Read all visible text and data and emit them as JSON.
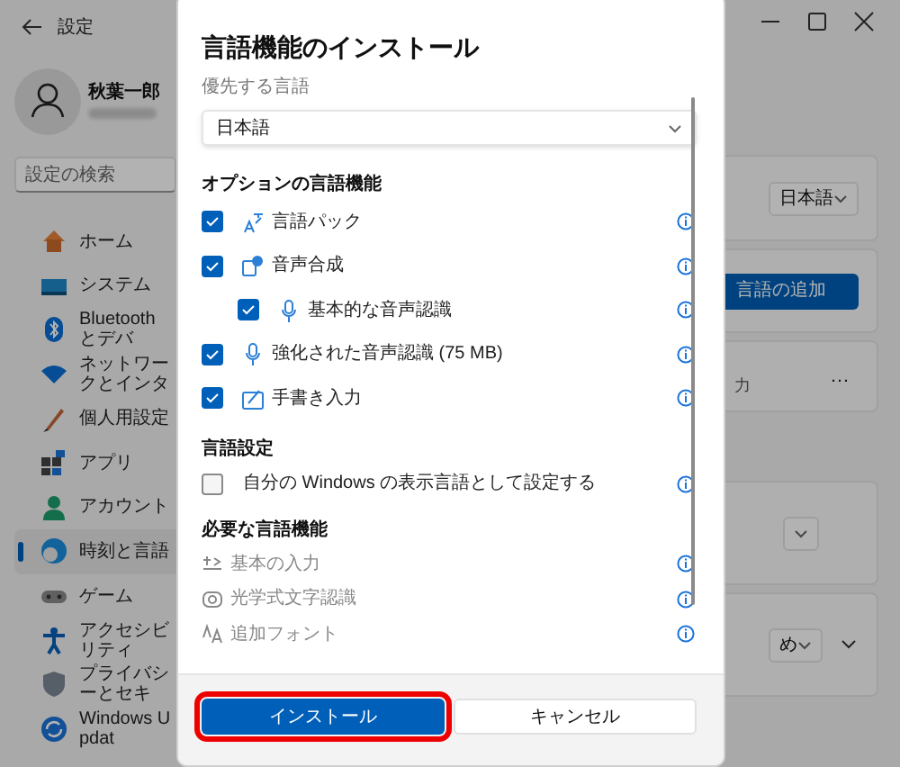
{
  "settings_window": {
    "title": "設定",
    "user": {
      "name": "秋葉一郎"
    },
    "search": {
      "placeholder": "設定の検索"
    },
    "sidebar": {
      "items": [
        {
          "label": "ホーム",
          "selected": false
        },
        {
          "label": "システム",
          "selected": false
        },
        {
          "label": "Bluetooth とデバ",
          "selected": false
        },
        {
          "label": "ネットワークとインタ",
          "selected": false
        },
        {
          "label": "個人用設定",
          "selected": false
        },
        {
          "label": "アプリ",
          "selected": false
        },
        {
          "label": "アカウント",
          "selected": false
        },
        {
          "label": "時刻と言語",
          "selected": true
        },
        {
          "label": "ゲーム",
          "selected": false
        },
        {
          "label": "アクセシビリティ",
          "selected": false
        },
        {
          "label": "プライバシーとセキ",
          "selected": false
        },
        {
          "label": "Windows Updat",
          "selected": false
        }
      ]
    },
    "cards": [
      {
        "kind": "dropdown",
        "value": "日本語"
      },
      {
        "kind": "button",
        "label": "言語の追加"
      },
      {
        "kind": "more",
        "text": "力",
        "menu": "…"
      },
      {
        "kind": "dropdown"
      },
      {
        "kind": "dropdown_expand",
        "value": "め"
      }
    ]
  },
  "dialog": {
    "title": "言語機能のインストール",
    "preferred_language": {
      "label": "優先する言語",
      "value": "日本語"
    },
    "optional_features": {
      "heading": "オプションの言語機能",
      "items": [
        {
          "label": "言語パック",
          "checked": true
        },
        {
          "label": "音声合成",
          "checked": true,
          "children": [
            {
              "label": "基本的な音声認識",
              "checked": true
            }
          ]
        },
        {
          "label": "強化された音声認識 (75 MB)",
          "checked": true
        },
        {
          "label": "手書き入力",
          "checked": true
        }
      ]
    },
    "language_settings": {
      "heading": "言語設定",
      "items": [
        {
          "label": "自分の Windows の表示言語として設定する",
          "checked": false
        }
      ]
    },
    "required_features": {
      "heading": "必要な言語機能",
      "items": [
        {
          "label": "基本の入力"
        },
        {
          "label": "光学式文字認識"
        },
        {
          "label": "追加フォント"
        }
      ]
    },
    "buttons": [
      {
        "label": "インストール",
        "kind": "primary",
        "highlighted": true
      },
      {
        "label": "キャンセル",
        "kind": "secondary",
        "highlighted": false
      }
    ]
  }
}
